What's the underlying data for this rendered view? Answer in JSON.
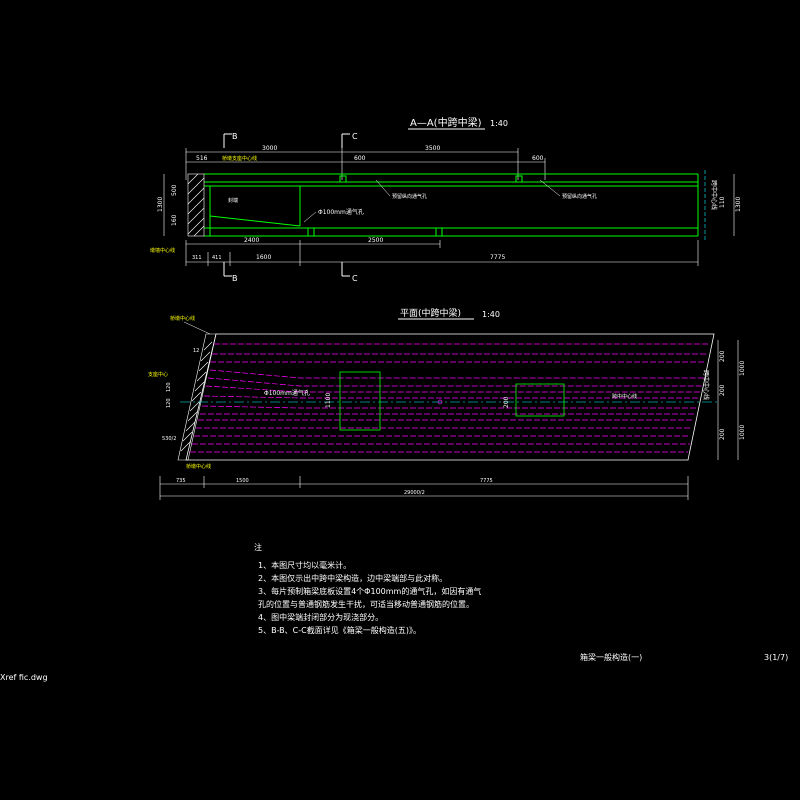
{
  "colors": {
    "background": "#000000",
    "green": "#00ff00",
    "white": "#ffffff",
    "magenta": "#ff00ff",
    "cyan": "#00ffff",
    "yellow": "#ffff00"
  },
  "section_view": {
    "title": "A—A(中跨中梁)",
    "scale": "1:40",
    "cut_b": "B",
    "cut_c": "C",
    "dims_top": [
      "3000",
      "3500"
    ],
    "dims_second": [
      "516",
      "600",
      "600"
    ],
    "dims_bottom1": [
      "2400",
      "2500"
    ],
    "dims_bottom2": [
      "311",
      "411",
      "1600",
      "7775"
    ],
    "left_vertical": [
      "1300",
      "500",
      "160"
    ],
    "right_vertical": [
      "1300",
      "110"
    ],
    "labels": {
      "bearing_line": "桥墩支座中心线",
      "pier_line": "墩墙中心线",
      "diaphragm1": "预留纵向通气孔",
      "diaphragm2": "预留纵向通气孔",
      "vent_hole": "Φ100mm通气孔",
      "seal": "封端",
      "right_text": "跨中中心线"
    }
  },
  "plan_view": {
    "title": "平面(中跨中梁)",
    "scale": "1:40",
    "dims_bottom": [
      "735",
      "1500",
      "7775"
    ],
    "total": "29000/2",
    "vent_hole": "Φ100mm通气孔",
    "left_dims": [
      "12",
      "120",
      "120",
      "530/2"
    ],
    "right_dims": [
      "200",
      "1000",
      "200",
      "200",
      "1000"
    ],
    "inner_dims": [
      "1100",
      "200"
    ],
    "labels": {
      "pier_line": "桥墩中心线",
      "bearing_center": "支座中心",
      "bottom_left": "桥墩中心线",
      "centerline": "跨中中心线",
      "right_rotated": "跨中中心线"
    }
  },
  "notes": {
    "heading": "注",
    "lines": [
      "1、本图尺寸均以毫米计。",
      "2、本图仅示出中跨中梁构造，边中梁端部与此对称。",
      "3、每片预制箱梁底板设置4个Φ100mm的通气孔，如因有通气",
      "   孔的位置与普通钢筋发生干扰，可适当移动普通钢筋的位置。",
      "4、图中梁端封闭部分为现浇部分。",
      "5、B-B、C-C截面详见《箱梁一般构造(五)》。"
    ]
  },
  "title_block": {
    "title": "箱梁一般构造(一)",
    "sheet": "3(1/7)"
  },
  "filename": "Xref fic.dwg"
}
